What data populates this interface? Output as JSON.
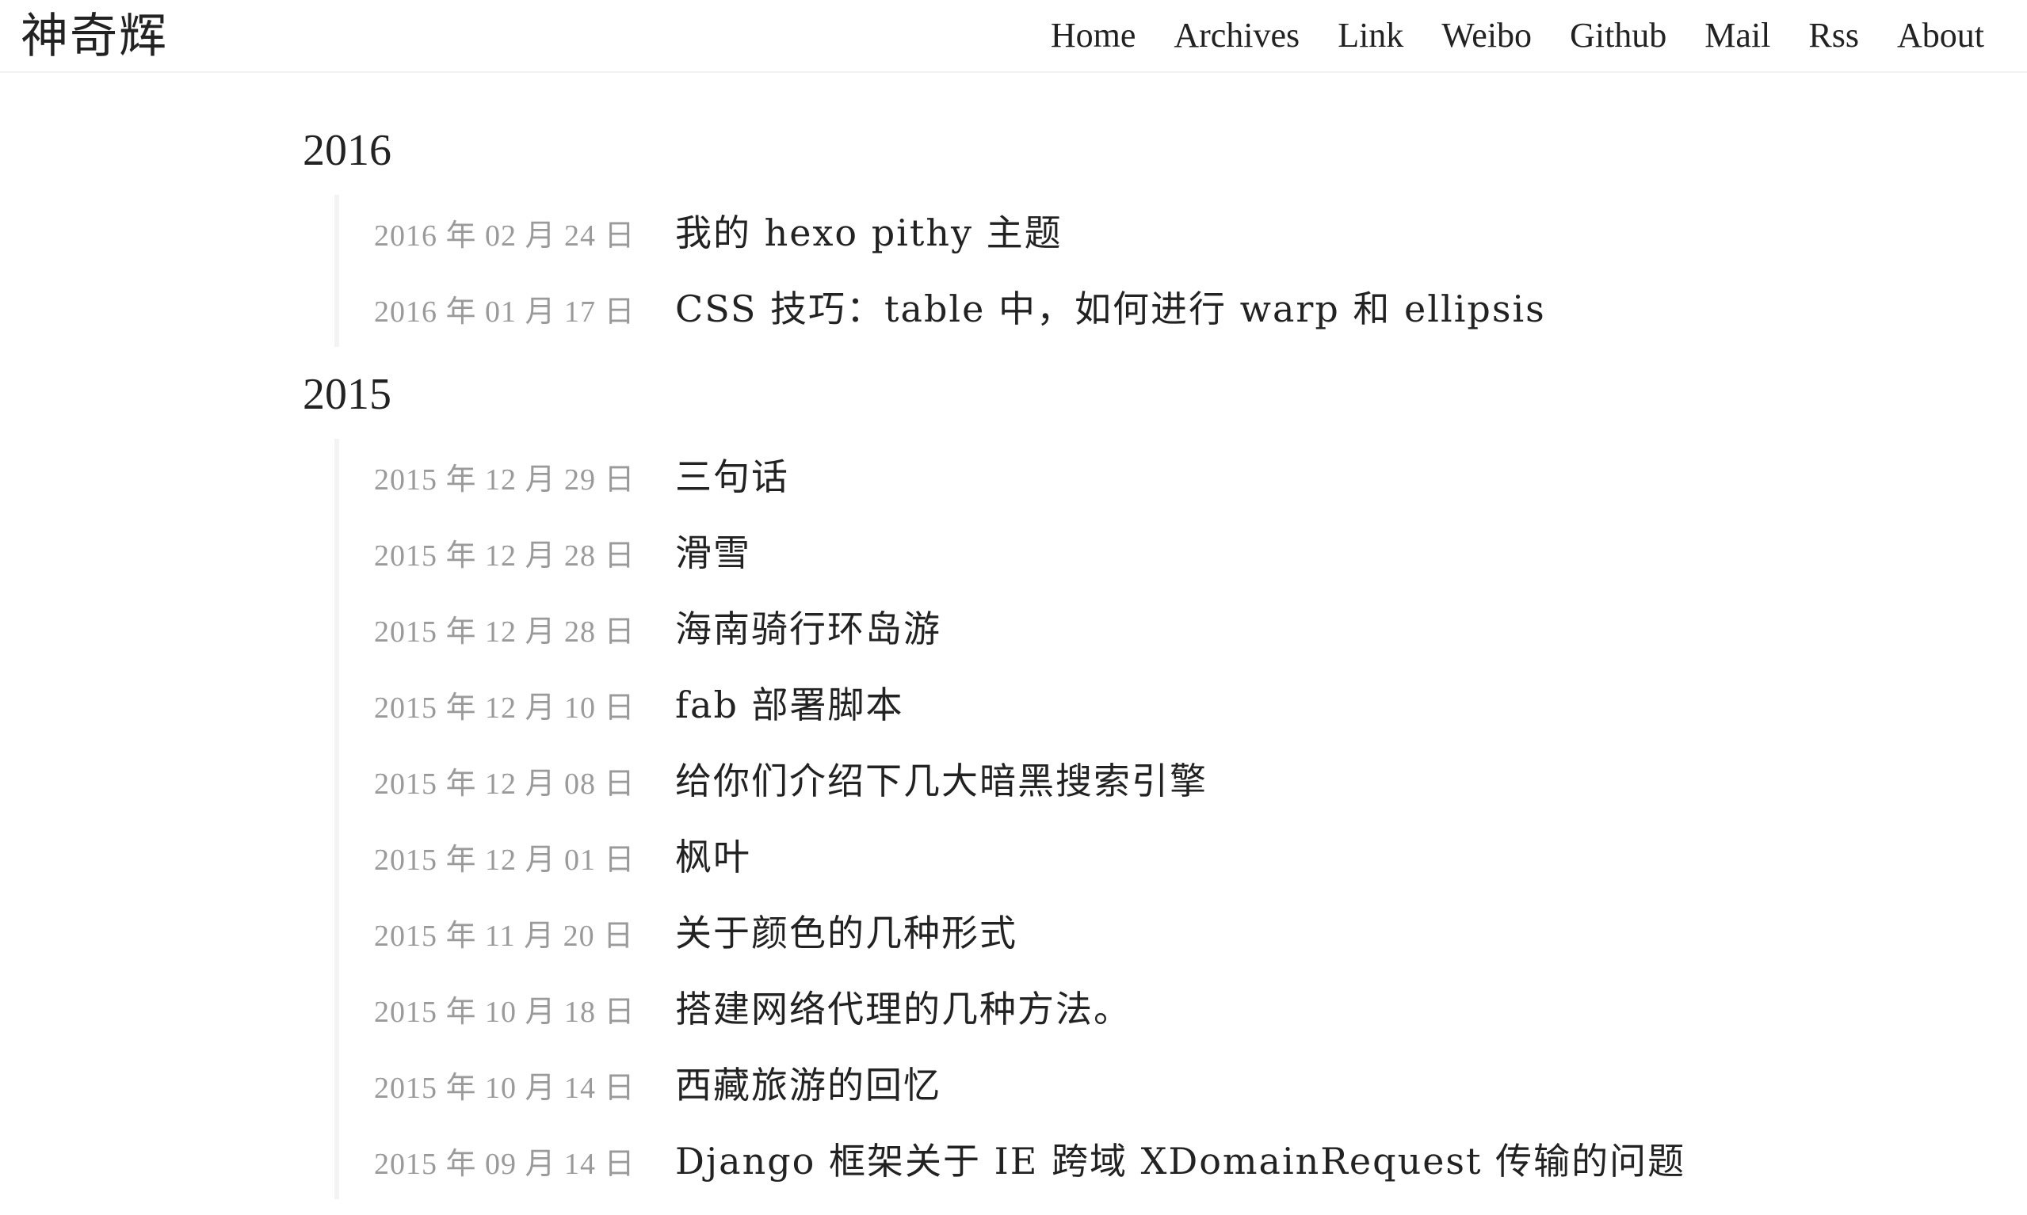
{
  "site": {
    "title": "神奇辉"
  },
  "nav": [
    {
      "label": "Home"
    },
    {
      "label": "Archives"
    },
    {
      "label": "Link"
    },
    {
      "label": "Weibo"
    },
    {
      "label": "Github"
    },
    {
      "label": "Mail"
    },
    {
      "label": "Rss"
    },
    {
      "label": "About"
    }
  ],
  "archives": [
    {
      "year": "2016",
      "posts": [
        {
          "date": "2016 年 02 月 24 日",
          "title": "我的 hexo pithy 主题"
        },
        {
          "date": "2016 年 01 月 17 日",
          "title": "CSS 技巧：table 中，如何进行 warp 和 ellipsis"
        }
      ]
    },
    {
      "year": "2015",
      "posts": [
        {
          "date": "2015 年 12 月 29 日",
          "title": "三句话"
        },
        {
          "date": "2015 年 12 月 28 日",
          "title": "滑雪"
        },
        {
          "date": "2015 年 12 月 28 日",
          "title": "海南骑行环岛游"
        },
        {
          "date": "2015 年 12 月 10 日",
          "title": "fab 部署脚本"
        },
        {
          "date": "2015 年 12 月 08 日",
          "title": "给你们介绍下几大暗黑搜索引擎"
        },
        {
          "date": "2015 年 12 月 01 日",
          "title": "枫叶"
        },
        {
          "date": "2015 年 11 月 20 日",
          "title": "关于颜色的几种形式"
        },
        {
          "date": "2015 年 10 月 18 日",
          "title": "搭建网络代理的几种方法。"
        },
        {
          "date": "2015 年 10 月 14 日",
          "title": "西藏旅游的回忆"
        },
        {
          "date": "2015 年 09 月 14 日",
          "title": "Django 框架关于 IE 跨域 XDomainRequest 传输的问题"
        }
      ]
    }
  ]
}
